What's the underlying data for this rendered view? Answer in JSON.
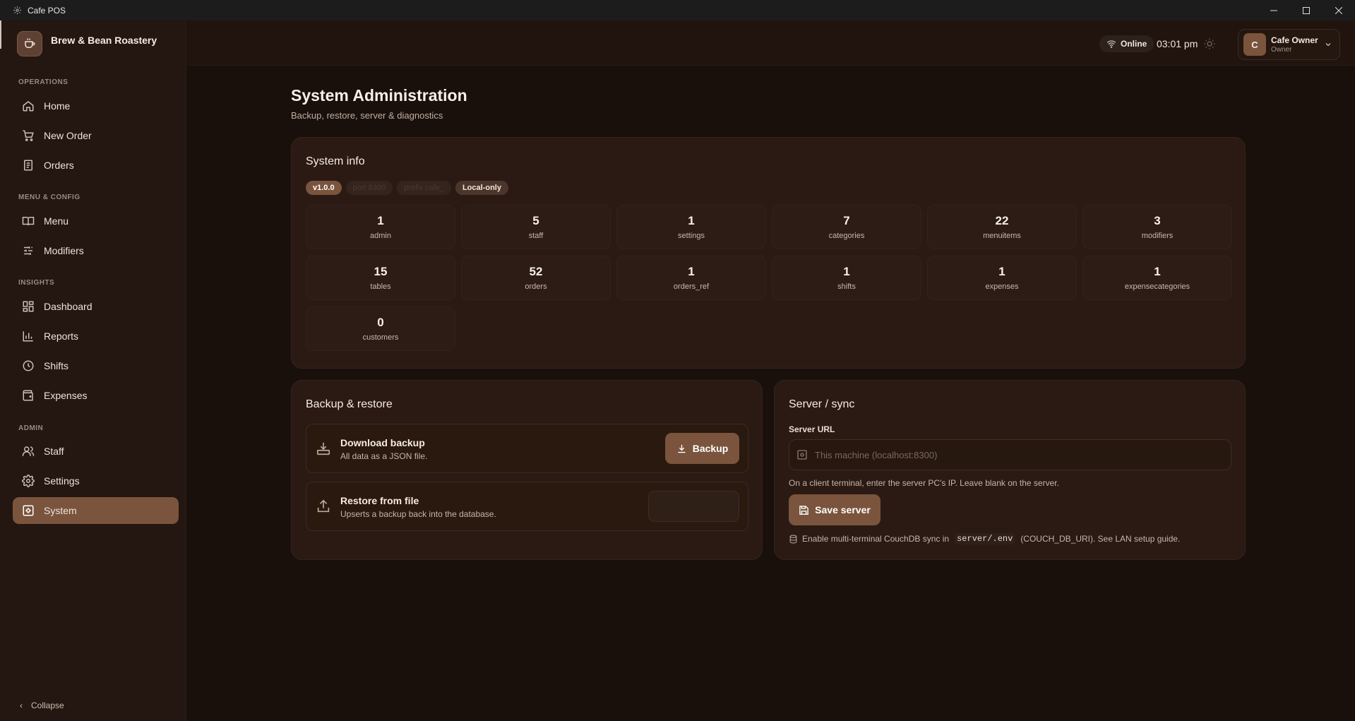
{
  "window": {
    "title": "Cafe POS"
  },
  "brand": {
    "name": "Brew & Bean Roastery"
  },
  "sidebar": {
    "sections": {
      "operations": "OPERATIONS",
      "menu_config": "MENU & CONFIG",
      "insights": "INSIGHTS",
      "admin": "ADMIN"
    },
    "items": [
      {
        "label": "Home",
        "icon": "home-icon"
      },
      {
        "label": "New Order",
        "icon": "cart-icon"
      },
      {
        "label": "Orders",
        "icon": "receipt-icon"
      },
      {
        "label": "Menu",
        "icon": "book-icon"
      },
      {
        "label": "Modifiers",
        "icon": "sliders-icon"
      },
      {
        "label": "Dashboard",
        "icon": "dashboard-icon"
      },
      {
        "label": "Reports",
        "icon": "bar-chart-icon"
      },
      {
        "label": "Shifts",
        "icon": "clock-icon"
      },
      {
        "label": "Expenses",
        "icon": "wallet-icon"
      },
      {
        "label": "Staff",
        "icon": "users-icon"
      },
      {
        "label": "Settings",
        "icon": "gear-icon"
      },
      {
        "label": "System",
        "icon": "system-icon",
        "active": true
      }
    ],
    "collapse_label": "Collapse"
  },
  "header": {
    "status": "Online",
    "time": "03:01 pm",
    "user": {
      "initial": "C",
      "name": "Cafe Owner",
      "role": "Owner"
    }
  },
  "page": {
    "title": "System Administration",
    "subtitle": "Backup, restore, server & diagnostics"
  },
  "system_info": {
    "title": "System info",
    "badges": {
      "version": "v1.0.0",
      "port": "port 8300",
      "prefix": "prefix cafe_",
      "mode": "Local-only"
    },
    "stats": [
      {
        "value": "1",
        "label": "admin"
      },
      {
        "value": "5",
        "label": "staff"
      },
      {
        "value": "1",
        "label": "settings"
      },
      {
        "value": "7",
        "label": "categories"
      },
      {
        "value": "22",
        "label": "menuitems"
      },
      {
        "value": "3",
        "label": "modifiers"
      },
      {
        "value": "15",
        "label": "tables"
      },
      {
        "value": "52",
        "label": "orders"
      },
      {
        "value": "1",
        "label": "orders_ref"
      },
      {
        "value": "1",
        "label": "shifts"
      },
      {
        "value": "1",
        "label": "expenses"
      },
      {
        "value": "1",
        "label": "expensecategories"
      },
      {
        "value": "0",
        "label": "customers"
      }
    ]
  },
  "backup": {
    "title": "Backup & restore",
    "download": {
      "title": "Download backup",
      "subtitle": "All data as a JSON file.",
      "button": "Backup"
    },
    "restore": {
      "title": "Restore from file",
      "subtitle": "Upserts a backup back into the database."
    }
  },
  "server": {
    "title": "Server / sync",
    "url_label": "Server URL",
    "url_placeholder": "This machine (localhost:8300)",
    "hint": "On a client terminal, enter the server PC's IP. Leave blank on the server.",
    "save_button": "Save server",
    "sync_note_prefix": "Enable multi-terminal CouchDB sync in",
    "sync_note_code": "server/.env",
    "sync_note_suffix": "(COUCH_DB_URI). See LAN setup guide."
  },
  "colors": {
    "accent": "#7a543d",
    "background": "#1a100b",
    "card": "#2a1a13"
  }
}
